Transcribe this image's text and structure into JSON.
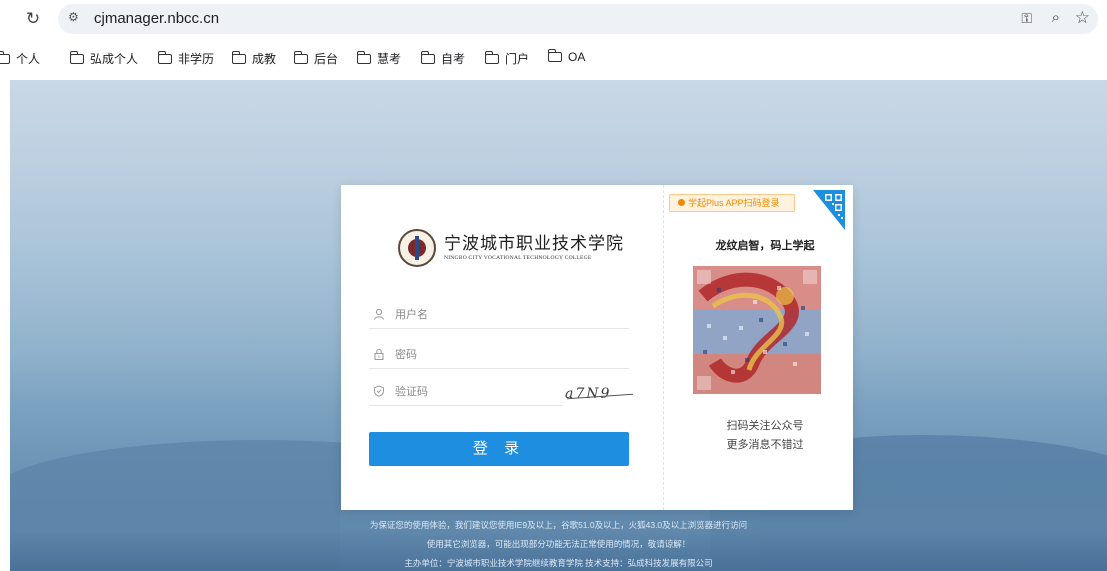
{
  "browser": {
    "reload_icon": "reload-icon",
    "site_info_icon": "tune-icon",
    "url": "cjmanager.nbcc.cn",
    "actions": [
      "key-icon",
      "zoom-icon",
      "star-icon"
    ]
  },
  "bookmarks": [
    {
      "label": "个人"
    },
    {
      "label": "弘成个人"
    },
    {
      "label": "非学历"
    },
    {
      "label": "成教"
    },
    {
      "label": "后台"
    },
    {
      "label": "慧考"
    },
    {
      "label": "自考"
    },
    {
      "label": "门户"
    },
    {
      "label": "OA"
    }
  ],
  "login": {
    "school_name": "宁波城市职业技术学院",
    "school_name_en": "NINGBO CITY VOCATIONAL TECHNOLOGY COLLEGE",
    "username_placeholder": "用户名",
    "password_placeholder": "密码",
    "captcha_placeholder": "验证码",
    "captcha_text": "a7N9",
    "submit_label": "登 录"
  },
  "qr_panel": {
    "tag": "学起Plus APP扫码登录",
    "slogan": "龙纹启智，码上学起",
    "caption_line1": "扫码关注公众号",
    "caption_line2": "更多消息不错过",
    "accent_color": "#f08a00"
  },
  "footer": {
    "line1": "为保证您的使用体验，我们建议您使用IE9及以上，谷歌51.0及以上，火狐43.0及以上浏览器进行访问",
    "line2": "使用其它浏览器，可能出现部分功能无法正常使用的情况，敬请谅解！",
    "line3": "主办单位：宁波城市职业技术学院继续教育学院 技术支持：弘成科技发展有限公司"
  },
  "colors": {
    "primary": "#1d8ee0",
    "sky": "#9ab8d0"
  }
}
